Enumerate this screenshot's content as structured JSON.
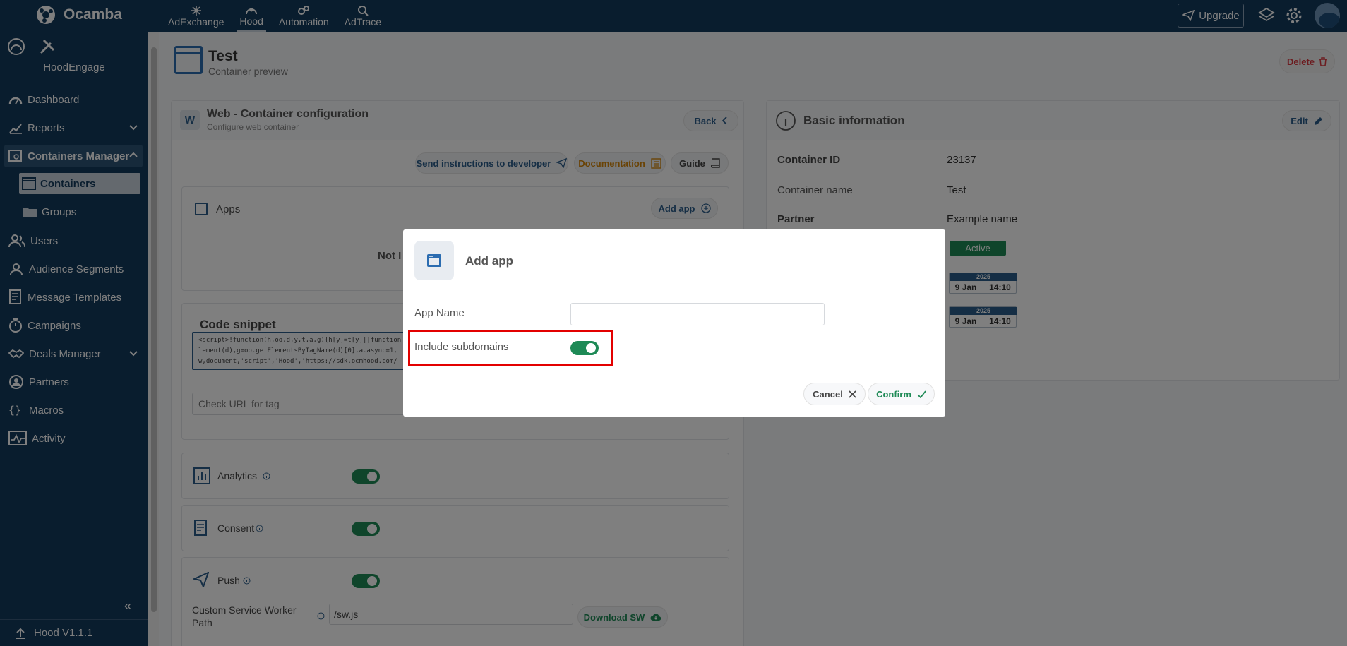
{
  "topbar": {
    "logo_text": "Ocamba",
    "nav": [
      "AdExchange",
      "Hood",
      "Automation",
      "AdTrace"
    ],
    "upgrade_label": "Upgrade"
  },
  "sidebar": {
    "app_name": "HoodEngage",
    "items": [
      {
        "label": "Dashboard"
      },
      {
        "label": "Reports"
      },
      {
        "label": "Containers Manager"
      },
      {
        "label": "Containers"
      },
      {
        "label": "Groups"
      },
      {
        "label": "Users"
      },
      {
        "label": "Audience Segments"
      },
      {
        "label": "Message Templates"
      },
      {
        "label": "Campaigns"
      },
      {
        "label": "Deals Manager"
      },
      {
        "label": "Partners"
      },
      {
        "label": "Macros"
      },
      {
        "label": "Activity"
      }
    ],
    "version": "Hood V1.1.1"
  },
  "page": {
    "title": "Test",
    "subtitle": "Container preview",
    "delete_label": "Delete"
  },
  "config": {
    "title": "Web - Container configuration",
    "subtitle": "Configure web container",
    "back_label": "Back",
    "send_label": "Send instructions to developer",
    "doc_label": "Documentation",
    "guide_label": "Guide",
    "apps_label": "Apps",
    "add_app_label": "Add app",
    "apps_empty_partial": "Not I",
    "snippet_title": "Code snippet",
    "snippet_lines": [
      "<script>!function(h,oo,d,y,t,a,g){h[y]=t[y]||function",
      "lement(d),g=oo.getElementsByTagName(d)[0],a.async=1,",
      "w,document,'script','Hood','https://sdk.ocmhood.com/"
    ],
    "check_url_placeholder": "Check URL for tag",
    "analytics_label": "Analytics",
    "consent_label": "Consent",
    "push_label": "Push",
    "sw_path_label_1": "Custom Service Worker",
    "sw_path_label_2": "Path",
    "sw_path_value": "/sw.js",
    "download_label": "Download SW"
  },
  "info": {
    "title": "Basic information",
    "edit_label": "Edit",
    "container_id_label": "Container ID",
    "container_id_value": "23137",
    "container_name_label": "Container name",
    "container_name_value": "Test",
    "partner_label": "Partner",
    "partner_value": "Example name",
    "status_value": "Active",
    "dates": [
      {
        "year": "2025",
        "day": "9 Jan",
        "time": "14:10"
      },
      {
        "year": "2025",
        "day": "9 Jan",
        "time": "14:10"
      }
    ],
    "status_color": "#1e8a56"
  },
  "modal": {
    "title": "Add app",
    "app_name_label": "App Name",
    "app_name_value": "",
    "subdomains_label": "Include subdomains",
    "subdomains_on": true,
    "cancel_label": "Cancel",
    "confirm_label": "Confirm"
  },
  "colors": {
    "topbar": "#133a5c",
    "accent": "#2b5d8a",
    "toggle_on": "#1e8a56",
    "danger": "#d9363e",
    "highlight": "#e30000"
  }
}
